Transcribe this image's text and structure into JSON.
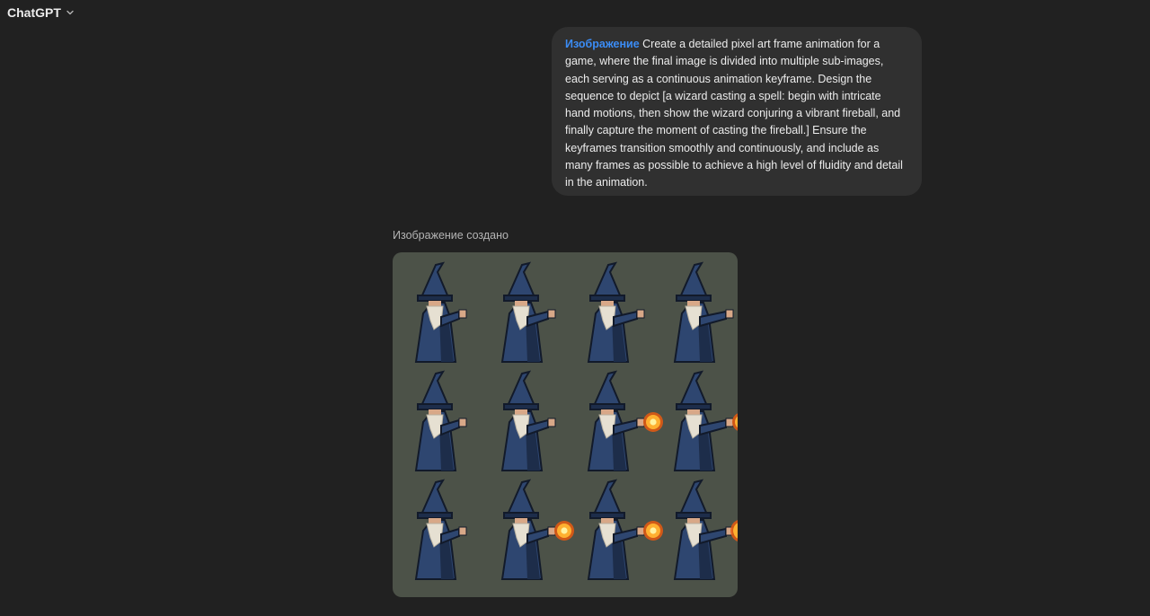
{
  "header": {
    "app_title": "ChatGPT",
    "model_menu_icon": "chevron-down-icon"
  },
  "conversation": {
    "user_message": {
      "tag": "Изображение",
      "text": "Create a detailed pixel art frame animation for a game, where the final image is divided into multiple sub-images, each serving as a continuous animation keyframe. Design the sequence to depict [a wizard casting a spell: begin with intricate hand motions, then show the wizard conjuring a vibrant fireball, and finally capture the moment of casting the fireball.] Ensure the keyframes transition smoothly and continuously, and include as many frames as possible to achieve a high level of fluidity and detail in the animation."
    },
    "assistant": {
      "status": "Изображение создано",
      "image": {
        "rows": 3,
        "columns": 4,
        "frames": [
          {
            "fireball": 0
          },
          {
            "fireball": 0
          },
          {
            "fireball": 0
          },
          {
            "fireball": 0
          },
          {
            "fireball": 0
          },
          {
            "fireball": 0
          },
          {
            "fireball": 1
          },
          {
            "fireball": 1
          },
          {
            "fireball": 0
          },
          {
            "fireball": 1
          },
          {
            "fireball": 1
          },
          {
            "fireball": 2
          }
        ],
        "colors": {
          "background": "#4c5248",
          "robe": "#2e4670",
          "robe_shadow": "#1d2d4a",
          "outline": "#121a2a",
          "beard": "#e6e0d2",
          "skin": "#d8a888",
          "fire_core": "#fff2a0",
          "fire_mid": "#ffb030",
          "fire_outer": "#e85a10"
        }
      }
    }
  }
}
